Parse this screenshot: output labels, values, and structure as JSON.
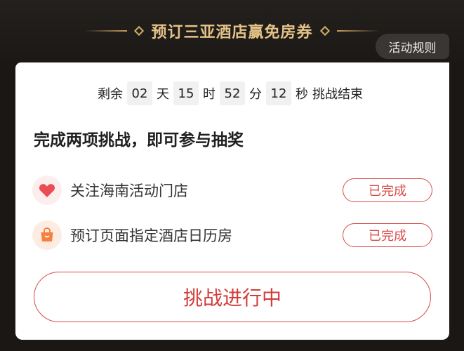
{
  "header": {
    "title": "预订三亚酒店赢免房券",
    "rules_label": "活动规则"
  },
  "countdown": {
    "prefix": "剩余",
    "days": "02",
    "day_unit": "天",
    "hours": "15",
    "hour_unit": "时",
    "minutes": "52",
    "minute_unit": "分",
    "seconds": "12",
    "second_unit": "秒",
    "suffix": "挑战结束"
  },
  "challenge": {
    "heading": "完成两项挑战，即可参与抽奖",
    "tasks": [
      {
        "icon": "heart-icon",
        "label": "关注海南活动门店",
        "status": "已完成"
      },
      {
        "icon": "shopping-bag-icon",
        "label": "预订页面指定酒店日历房",
        "status": "已完成"
      }
    ],
    "main_button": "挑战进行中"
  },
  "colors": {
    "accent_red": "#d94a47",
    "gold": "#e4c287",
    "background": "#1a1715"
  }
}
